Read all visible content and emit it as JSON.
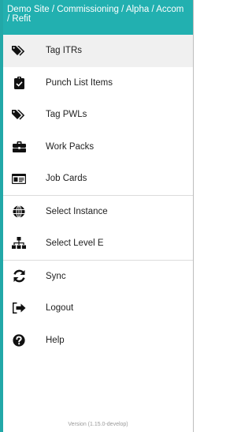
{
  "header": {
    "breadcrumb": "Demo Site / Commissioning / Alpha / Accom / Refit"
  },
  "menu": {
    "group1": [
      {
        "label": "Tag ITRs",
        "icon": "tags-icon"
      },
      {
        "label": "Punch List Items",
        "icon": "clipboard-check-icon"
      },
      {
        "label": "Tag PWLs",
        "icon": "tags-icon"
      },
      {
        "label": "Work Packs",
        "icon": "briefcase-icon"
      },
      {
        "label": "Job Cards",
        "icon": "id-card-icon"
      }
    ],
    "group2": [
      {
        "label": "Select Instance",
        "icon": "globe-icon"
      },
      {
        "label": "Select Level E",
        "icon": "sitemap-icon"
      }
    ],
    "group3": [
      {
        "label": "Sync",
        "icon": "sync-icon"
      },
      {
        "label": "Logout",
        "icon": "sign-out-icon"
      },
      {
        "label": "Help",
        "icon": "question-circle-icon"
      }
    ]
  },
  "footer": {
    "version": "Version (1.15.0-develop)"
  },
  "colors": {
    "header_bg": "#22b0b0",
    "active_bg": "#f0f0f0"
  }
}
